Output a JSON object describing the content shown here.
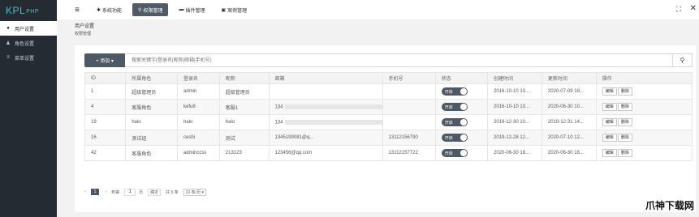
{
  "logo": {
    "main": "KPL",
    "suffix": "PHP"
  },
  "sidebar": {
    "items": [
      {
        "icon": "user-icon",
        "glyph": "●",
        "label": "用户设置",
        "active": true
      },
      {
        "icon": "users-icon",
        "glyph": "♟",
        "label": "角色设置",
        "active": false
      },
      {
        "icon": "list-icon",
        "glyph": "≡",
        "label": "菜单设置",
        "active": false
      }
    ]
  },
  "topbar": {
    "tabs": [
      {
        "icon": "gear-icon",
        "glyph": "✱",
        "label": "系统功能",
        "active": false
      },
      {
        "icon": "key-icon",
        "glyph": "⚲",
        "label": "权限管理",
        "active": true
      },
      {
        "icon": "folder-icon",
        "glyph": "▬",
        "label": "插件管理",
        "active": false
      },
      {
        "icon": "image-icon",
        "glyph": "▣",
        "label": "案例管理",
        "active": false
      }
    ]
  },
  "breadcrumb": {
    "title": "用户设置",
    "sub": "权限管理"
  },
  "toolbar": {
    "add_label": "+ 添加 ▾",
    "search_placeholder": "搜索关键字(登录名|昵称|邮箱|手机号)"
  },
  "table": {
    "headers": [
      "ID",
      "所属角色",
      "登录名",
      "昵称",
      "邮箱",
      "手机号",
      "状态",
      "创建时间",
      "更新时间",
      "操作"
    ],
    "rows": [
      {
        "id": "1",
        "role": "超级管理员",
        "login": "admin",
        "nickname": "超级管理员",
        "email": "",
        "phone": "",
        "status": "开启",
        "created": "2016-10-10 10...",
        "updated": "2020-07-09 18..."
      },
      {
        "id": "4",
        "role": "客服角色",
        "login": "kefu8",
        "nickname": "客服1",
        "email": "134",
        "phone": "",
        "status": "开启",
        "created": "2016-10-10 10...",
        "updated": "2020-06-30 10..."
      },
      {
        "id": "19",
        "role": "halo",
        "login": "halo",
        "nickname": "halo",
        "email": "134",
        "phone": "",
        "status": "开启",
        "created": "2019-12-30 10...",
        "updated": "2019-12-31 14..."
      },
      {
        "id": "16",
        "role": "测试组",
        "login": "ceshi",
        "nickname": "测试",
        "email": "1345199081@q...",
        "phone": "13112156790",
        "status": "开启",
        "created": "2019-12-28 12...",
        "updated": "2020-07-10 12..."
      },
      {
        "id": "42",
        "role": "客服角色",
        "login": "adminccss",
        "nickname": "213123",
        "email": "123456@qq.com",
        "phone": "13112157722",
        "status": "开启",
        "created": "2020-06-30 18...",
        "updated": "2020-06-30 18..."
      }
    ],
    "edit_label": "编辑",
    "delete_label": "删除"
  },
  "pager": {
    "prev": "‹",
    "current": "1",
    "next": "›",
    "goto_label": "到第",
    "page_value": "1",
    "page_unit": "页",
    "confirm": "确定",
    "total": "共 5 条",
    "size": "20 条/页 ▾"
  },
  "window": {
    "fullscreen_glyph": "⛶",
    "close_glyph": "✕"
  },
  "watermark": "爪神下载网"
}
